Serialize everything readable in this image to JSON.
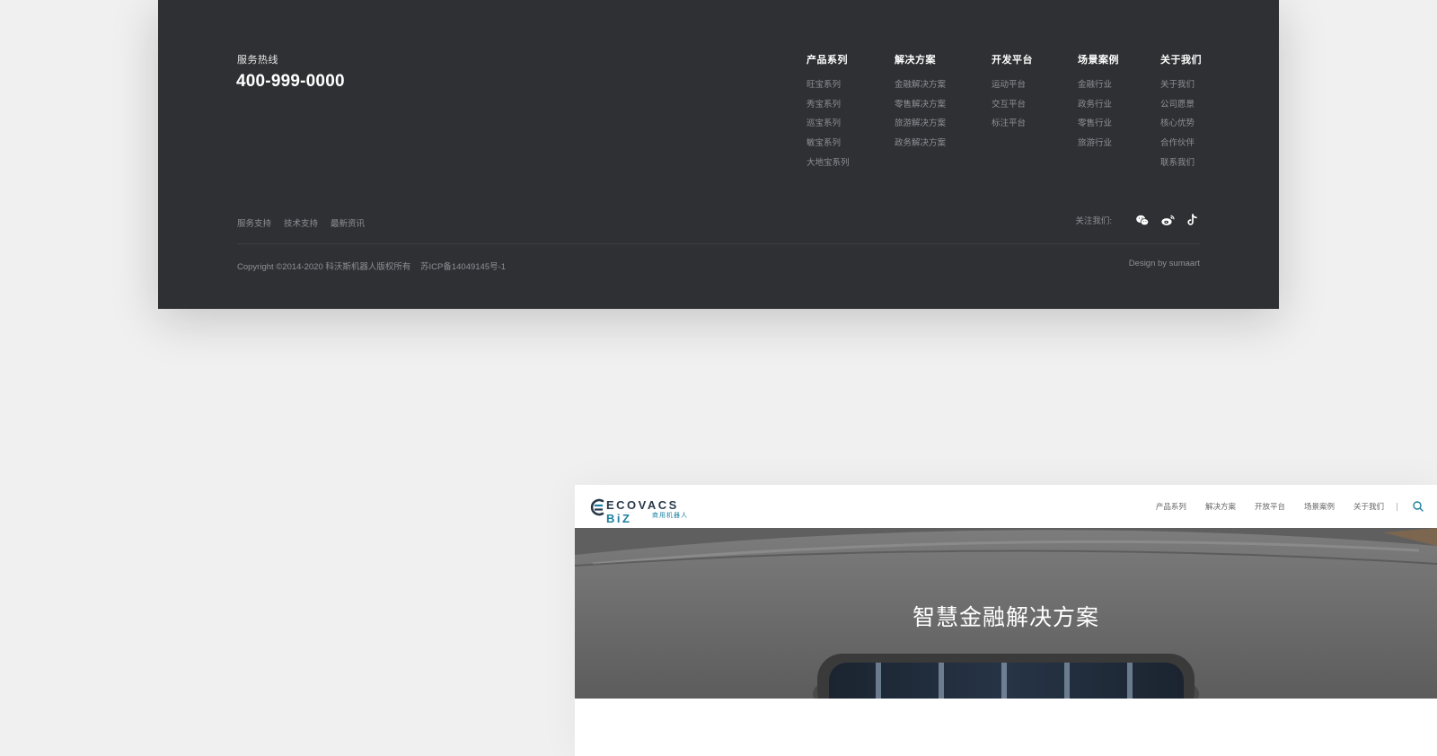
{
  "footer": {
    "hotline_label": "服务热线",
    "hotline_number": "400-999-0000",
    "columns": [
      {
        "title": "产品系列",
        "items": [
          "旺宝系列",
          "秀宝系列",
          "巡宝系列",
          "敏宝系列",
          "大地宝系列"
        ]
      },
      {
        "title": "解决方案",
        "items": [
          "金融解决方案",
          "零售解决方案",
          "旅游解决方案",
          "政务解决方案"
        ]
      },
      {
        "title": "开发平台",
        "items": [
          "运动平台",
          "交互平台",
          "标注平台"
        ]
      },
      {
        "title": "场景案例",
        "items": [
          "金融行业",
          "政务行业",
          "零售行业",
          "旅游行业"
        ]
      },
      {
        "title": "关于我们",
        "items": [
          "关于我们",
          "公司愿景",
          "核心优势",
          "合作伙伴",
          "联系我们"
        ]
      }
    ],
    "bottom_links": [
      "服务支持",
      "技术支持",
      "最新资讯"
    ],
    "follow_label": "关注我们:",
    "social_icons": [
      "wechat-icon",
      "weibo-icon",
      "tiktok-icon"
    ],
    "copyright": "Copyright ©2014-2020 科沃斯机器人版权所有",
    "icp": "苏ICP备14049145号-1",
    "design_by": "Design by sumaart"
  },
  "site": {
    "logo_text_main": "ECOVACS",
    "logo_text_biz": "BiZ",
    "logo_sub": "商用机器人",
    "nav": [
      "产品系列",
      "解决方案",
      "开放平台",
      "场景案例",
      "关于我们"
    ],
    "hero_title": "智慧金融解决方案",
    "accent_color": "#1b7fa0"
  }
}
